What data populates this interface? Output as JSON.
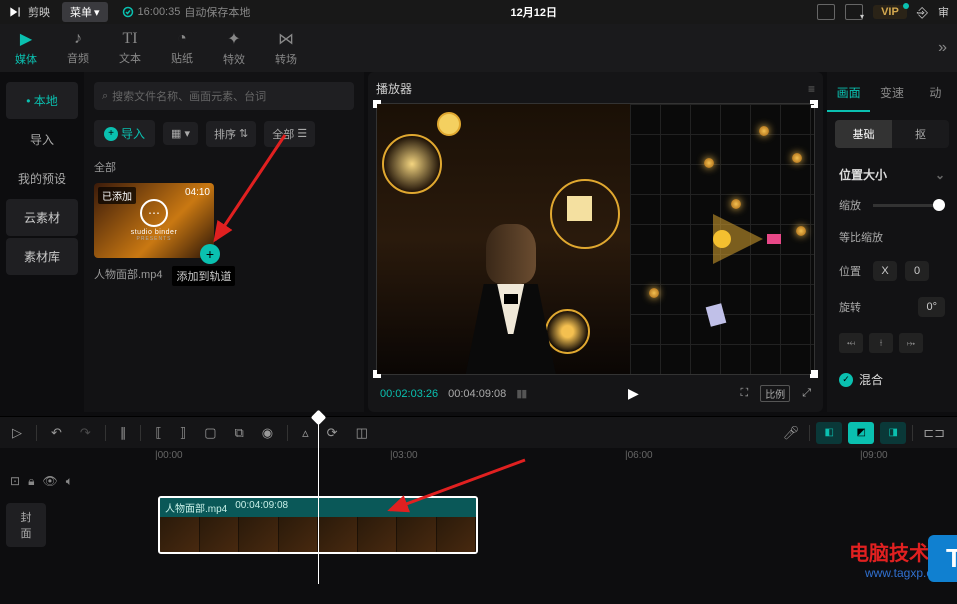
{
  "topbar": {
    "brand": "剪映",
    "menu": "菜单",
    "autosave_time": "16:00:35",
    "autosave_text": "自动保存本地",
    "title": "12月12日",
    "vip": "VIP",
    "review": "审"
  },
  "mainTabs": {
    "media": "媒体",
    "audio": "音频",
    "text": "文本",
    "sticker": "贴纸",
    "effect": "特效",
    "transition": "转场"
  },
  "sideNav": {
    "local": "本地",
    "import": "导入",
    "presets": "我的预设",
    "cloud": "云素材",
    "library": "素材库"
  },
  "media": {
    "search_placeholder": "搜索文件名称、画面元素、台词",
    "import_btn": "导入",
    "sort": "排序",
    "all_filter": "全部",
    "category": "全部",
    "thumb_badge": "已添加",
    "thumb_time": "04:10",
    "thumb_studio": "studio binder",
    "thumb_presents": "PRESENTS",
    "thumb_name": "人物面部.mp4",
    "thumb_tooltip": "添加到轨道"
  },
  "preview": {
    "title": "播放器",
    "time_current": "00:02:03:26",
    "time_total": "00:04:09:08",
    "ratio": "比例"
  },
  "props": {
    "tab_picture": "画面",
    "tab_speed": "变速",
    "tab_anim": "动",
    "subtab_basic": "基础",
    "subtab_mask": "抠",
    "section_pos": "位置大小",
    "scale": "缩放",
    "scale_lock": "等比缩放",
    "position": "位置",
    "pos_x_label": "X",
    "pos_x_val": "0",
    "rotation": "旋转",
    "rotation_val": "0°",
    "blend": "混合"
  },
  "timeline": {
    "ruler": {
      "t0": "|00:00",
      "t1": "|03:00",
      "t2": "|06:00",
      "t3": "|09:00"
    },
    "cover": "封面",
    "clip_name": "人物面部.mp4",
    "clip_duration": "00:04:09:08"
  },
  "watermark": {
    "line1": "电脑技术网",
    "line2": "www.tagxp.com",
    "tag": "TAG"
  }
}
